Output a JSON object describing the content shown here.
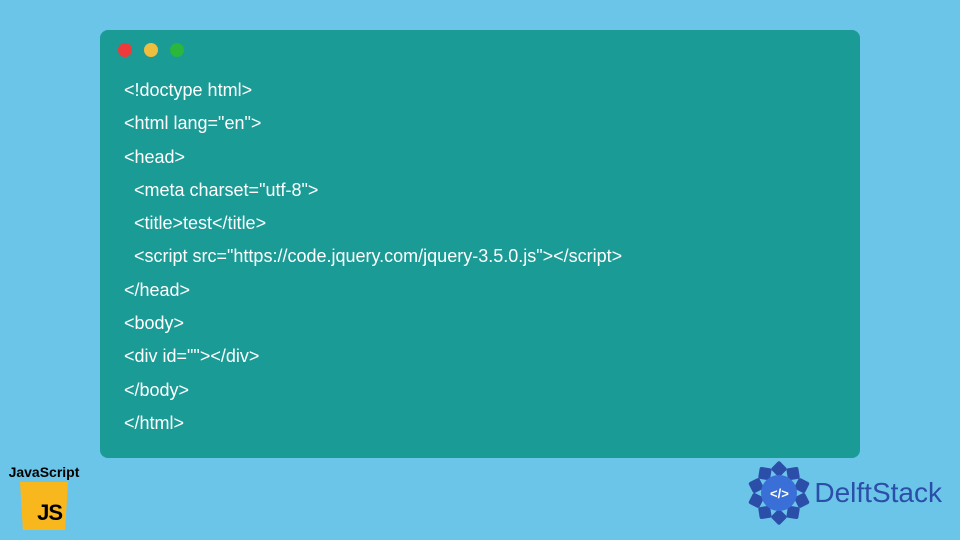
{
  "code_lines": [
    "<!doctype html>",
    "<html lang=\"en\">",
    "<head>",
    "  <meta charset=\"utf-8\">",
    "  <title>test</title>",
    "  <script src=\"https://code.jquery.com/jquery-3.5.0.js\"></script>",
    "</head>",
    "<body>",
    "<div id=\"\"></div>",
    "</body>",
    "</html>"
  ],
  "js_badge": {
    "label": "JavaScript",
    "icon_text": "JS"
  },
  "delft": {
    "icon_text": "</>",
    "brand": "DelftStack"
  },
  "colors": {
    "page_bg": "#6bc5e8",
    "window_bg": "#1a9b96",
    "js_yellow": "#f7b71d",
    "delft_blue": "#2b4ea8"
  }
}
